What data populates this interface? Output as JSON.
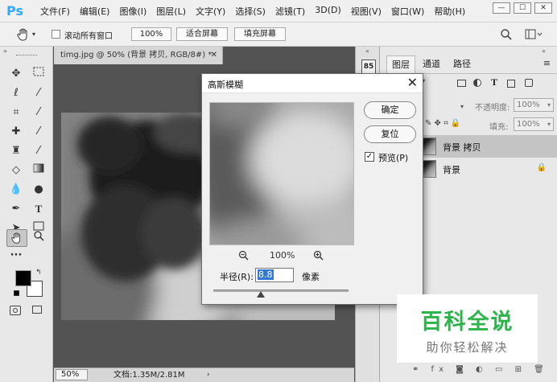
{
  "app": {
    "logo": "Ps"
  },
  "menu": [
    "文件(F)",
    "编辑(E)",
    "图像(I)",
    "图层(L)",
    "文字(Y)",
    "选择(S)",
    "滤镜(T)",
    "3D(D)",
    "视图(V)",
    "窗口(W)",
    "帮助(H)"
  ],
  "options_bar": {
    "scroll_all_windows": "滚动所有窗口",
    "zoom_level": "100%",
    "fit_screen": "适合屏幕",
    "fill_screen": "填充屏幕"
  },
  "document": {
    "tab_title": "timg.jpg @ 50% (背景 拷贝, RGB/8#) *",
    "status_zoom": "50%",
    "status_doc": "文档:1.35M/2.81M"
  },
  "layers_panel": {
    "tabs": [
      "图层",
      "通道",
      "路径"
    ],
    "opacity_label": "不透明度:",
    "opacity_value": "100%",
    "fill_label": "填充:",
    "fill_value": "100%",
    "layers": [
      {
        "name": "背景 拷贝",
        "selected": true
      },
      {
        "name": "背景",
        "locked": true
      }
    ]
  },
  "dialog": {
    "title": "高斯模糊",
    "ok": "确定",
    "reset": "复位",
    "preview_label": "预览(P)",
    "preview_checked": true,
    "zoom": "100%",
    "radius_label": "半径(R):",
    "radius_value": "8.8",
    "radius_unit": "像素",
    "slider_fraction": 0.35
  },
  "watermark": {
    "line1": "百科全说",
    "line2": "助你轻松解决"
  }
}
